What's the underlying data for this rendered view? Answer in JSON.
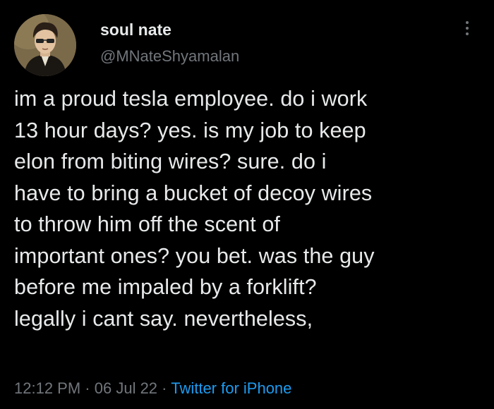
{
  "author": {
    "display_name": "soul nate",
    "handle": "@MNateShyamalan"
  },
  "tweet": {
    "text": "im a proud tesla employee. do i work\n13 hour days? yes. is my job to keep\nelon from biting wires? sure. do i\nhave to bring a bucket of decoy wires\nto throw him off the scent of\nimportant ones? you bet. was the guy\nbefore me impaled by a forklift?\nlegally i cant say. nevertheless,"
  },
  "meta": {
    "time": "12:12 PM",
    "separator": "·",
    "date": "06 Jul 22",
    "source": "Twitter for iPhone"
  },
  "icons": {
    "more": "more-vertical-icon"
  },
  "colors": {
    "background": "#000000",
    "primary_text": "#e7e9ea",
    "secondary_text": "#71767b",
    "link": "#1d9bf0"
  }
}
